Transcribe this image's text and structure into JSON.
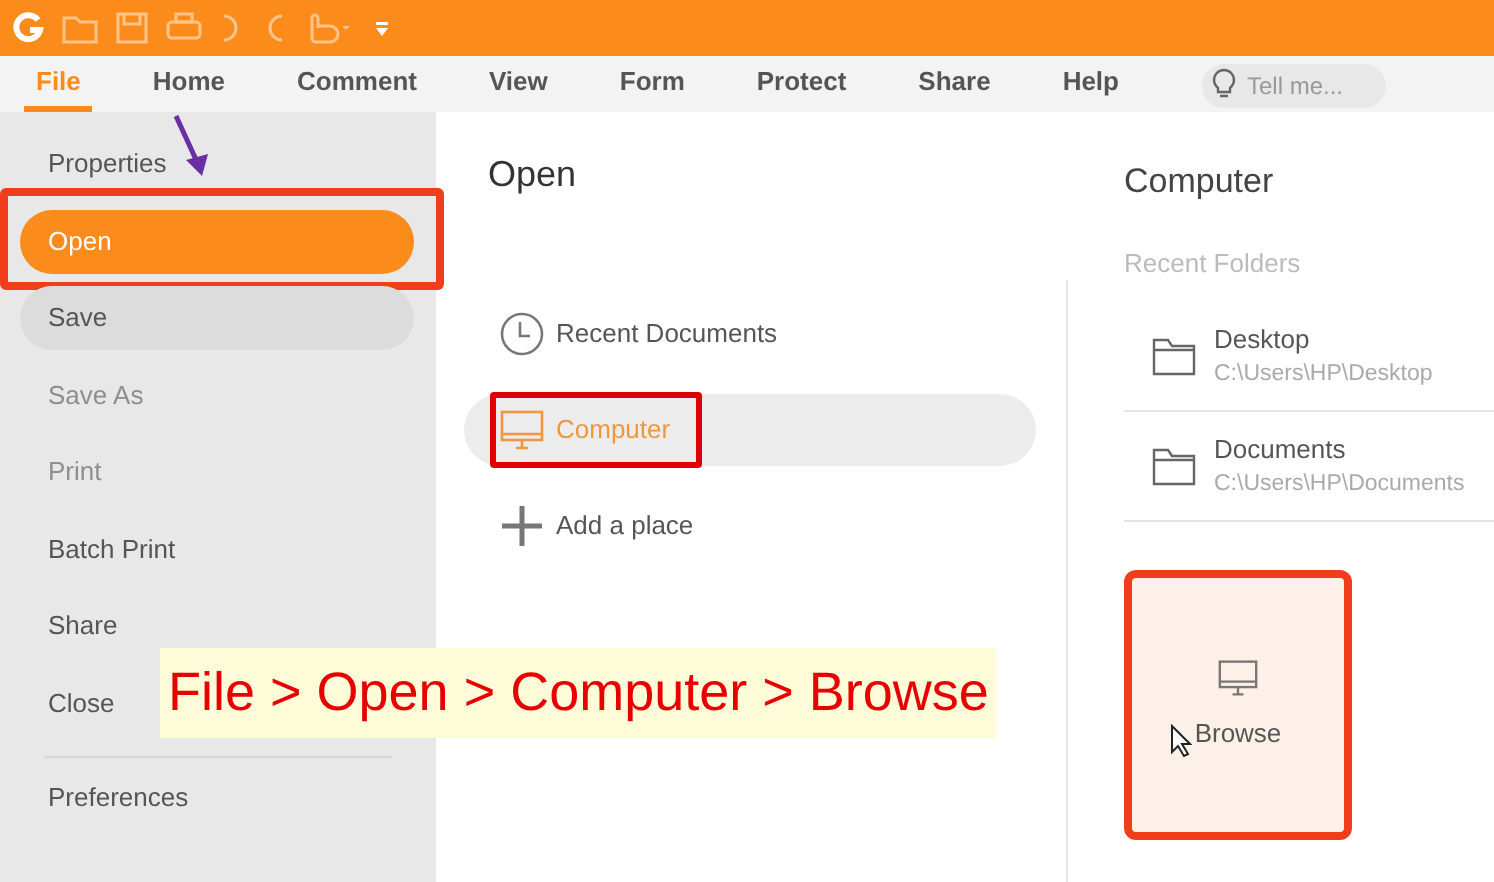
{
  "ribbon_tabs": [
    {
      "label": "File",
      "selected": true
    },
    {
      "label": "Home",
      "selected": false
    },
    {
      "label": "Comment",
      "selected": false
    },
    {
      "label": "View",
      "selected": false
    },
    {
      "label": "Form",
      "selected": false
    },
    {
      "label": "Protect",
      "selected": false
    },
    {
      "label": "Share",
      "selected": false
    },
    {
      "label": "Help",
      "selected": false
    }
  ],
  "search": {
    "placeholder": "Tell me..."
  },
  "sidebar": {
    "items": [
      {
        "label": "Properties",
        "selected": false,
        "hovered": false,
        "disabled": false,
        "highlighted": false
      },
      {
        "label": "Open",
        "selected": true,
        "hovered": false,
        "disabled": false,
        "highlighted": true
      },
      {
        "label": "Save",
        "selected": false,
        "hovered": true,
        "disabled": false,
        "highlighted": false
      },
      {
        "label": "Save As",
        "selected": false,
        "hovered": false,
        "disabled": true,
        "highlighted": false
      },
      {
        "label": "Print",
        "selected": false,
        "hovered": false,
        "disabled": true,
        "highlighted": false
      },
      {
        "label": "Batch Print",
        "selected": false,
        "hovered": false,
        "disabled": false,
        "highlighted": false
      },
      {
        "label": "Share",
        "selected": false,
        "hovered": false,
        "disabled": false,
        "highlighted": false
      },
      {
        "label": "Close",
        "selected": false,
        "hovered": false,
        "disabled": false,
        "highlighted": false
      },
      {
        "label": "Preferences",
        "selected": false,
        "hovered": false,
        "disabled": false,
        "highlighted": false
      }
    ]
  },
  "open_panel": {
    "title": "Open",
    "places": [
      {
        "label": "Recent Documents",
        "kind": "clock",
        "selected": false,
        "highlighted": false
      },
      {
        "label": "Computer",
        "kind": "monitor",
        "selected": true,
        "highlighted": true
      },
      {
        "label": "Add a place",
        "kind": "plus",
        "selected": false,
        "highlighted": false
      }
    ]
  },
  "computer_panel": {
    "title": "Computer",
    "section": "Recent Folders",
    "folders": [
      {
        "name": "Desktop",
        "path": "C:\\Users\\HP\\Desktop"
      },
      {
        "name": "Documents",
        "path": "C:\\Users\\HP\\Documents"
      }
    ],
    "browse": {
      "label": "Browse",
      "highlighted": true
    }
  },
  "caption": "File > Open > Computer > Browse"
}
